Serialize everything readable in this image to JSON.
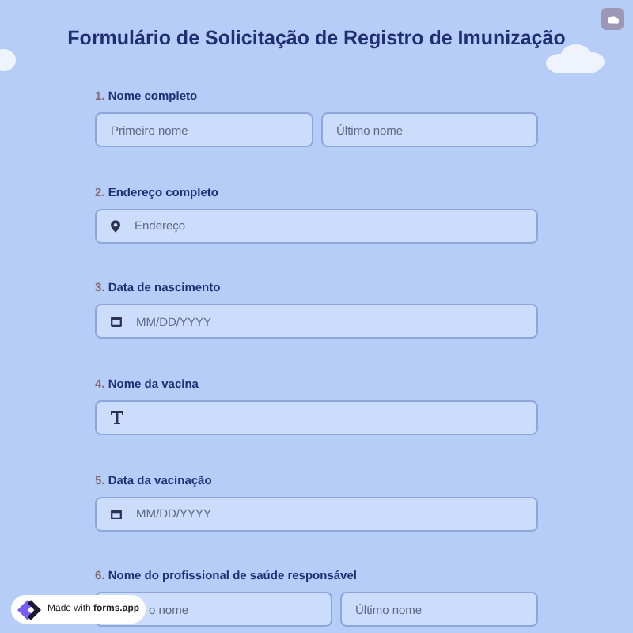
{
  "title": "Formulário de Solicitação de Registro de Imunização",
  "questions": [
    {
      "number": "1.",
      "label": "Nome completo",
      "kind": "name",
      "fields": [
        {
          "placeholder": "Primeiro nome"
        },
        {
          "placeholder": "Último nome"
        }
      ]
    },
    {
      "number": "2.",
      "label": "Endereço completo",
      "kind": "address",
      "fields": [
        {
          "placeholder": "Endereço"
        }
      ]
    },
    {
      "number": "3.",
      "label": "Data de nascimento",
      "kind": "date",
      "fields": [
        {
          "placeholder": "MM/DD/YYYY"
        }
      ]
    },
    {
      "number": "4.",
      "label": "Nome da vacina",
      "kind": "text"
    },
    {
      "number": "5.",
      "label": "Data da vacinação",
      "kind": "date",
      "fields": [
        {
          "placeholder": "MM/DD/YYYY"
        }
      ]
    },
    {
      "number": "6.",
      "label": "Nome do profissional de saúde responsável",
      "kind": "name",
      "fields": [
        {
          "placeholder": "o nome",
          "covered": true
        },
        {
          "placeholder": "Último nome"
        }
      ]
    }
  ],
  "badge": {
    "prefix": "Made with",
    "brand": "forms.app"
  }
}
